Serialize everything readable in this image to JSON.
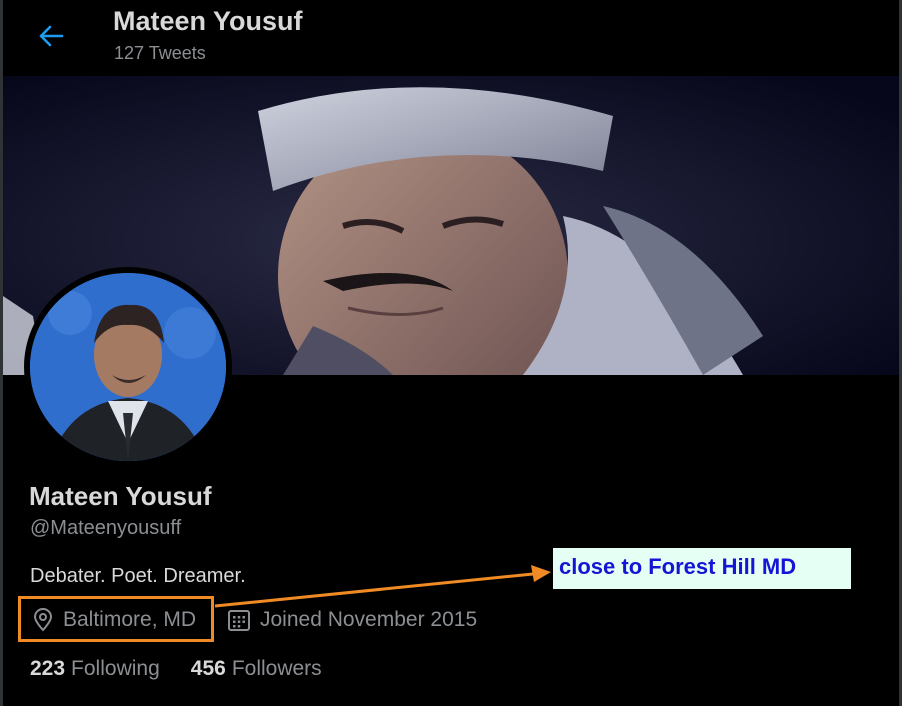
{
  "header": {
    "name": "Mateen Yousuf",
    "tweet_count": "127 Tweets"
  },
  "profile": {
    "name": "Mateen Yousuf",
    "handle": "@Mateenyousuff",
    "bio": "Debater. Poet. Dreamer.",
    "location": "Baltimore, MD",
    "joined": "Joined November 2015",
    "following_count": "223",
    "following_label": "Following",
    "followers_count": "456",
    "followers_label": "Followers"
  },
  "annotation": {
    "text": "close to Forest Hill MD"
  },
  "icons": {
    "back": "back-arrow-icon",
    "location": "location-pin-icon",
    "joined": "calendar-icon"
  },
  "colors": {
    "accent": "#1d9bf0",
    "highlight_box": "#f08a24",
    "annotation_bg": "#e6fff4",
    "annotation_text": "#1515d6"
  }
}
